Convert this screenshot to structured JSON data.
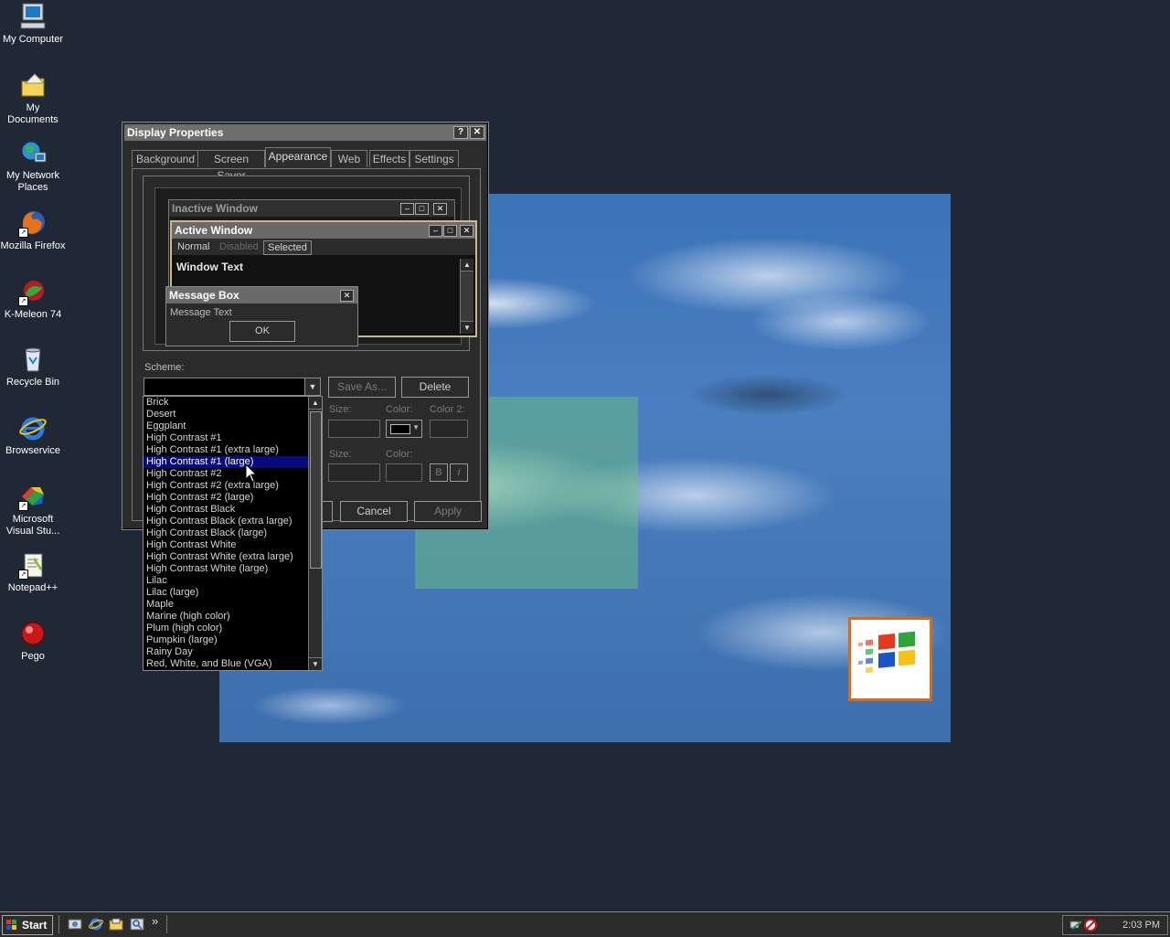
{
  "desktop": {
    "icons": [
      {
        "label": "My Computer"
      },
      {
        "label": "My Documents"
      },
      {
        "label": "My Network Places"
      },
      {
        "label": "Mozilla Firefox"
      },
      {
        "label": "K-Meleon 74"
      },
      {
        "label": "Recycle Bin"
      },
      {
        "label": "Browservice"
      },
      {
        "label": "Microsoft Visual Stu..."
      },
      {
        "label": "Notepad++"
      },
      {
        "label": "Pego"
      }
    ]
  },
  "dialog": {
    "title": "Display Properties",
    "help_glyph": "?",
    "close_glyph": "✕",
    "tabs": [
      "Background",
      "Screen Saver",
      "Appearance",
      "Web",
      "Effects",
      "Settings"
    ],
    "active_tab": "Appearance",
    "preview": {
      "inactive_title": "Inactive Window",
      "active_title": "Active Window",
      "menu_normal": "Normal",
      "menu_disabled": "Disabled",
      "menu_selected": "Selected",
      "window_text": "Window Text",
      "msgbox_title": "Message Box",
      "msgbox_text": "Message Text",
      "msgbox_ok": "OK"
    },
    "scheme_label": "Scheme:",
    "scheme_value": "",
    "save_as": "Save As...",
    "delete": "Delete",
    "size_label": "Size:",
    "color_label": "Color:",
    "color2_label": "Color 2:",
    "size2_label": "Size:",
    "color3_label": "Color:",
    "bold_label": "B",
    "italic_label": "I",
    "cancel": "Cancel",
    "apply": "Apply"
  },
  "scheme_list": {
    "items": [
      "Brick",
      "Desert",
      "Eggplant",
      "High Contrast #1",
      "High Contrast #1 (extra large)",
      "High Contrast #1 (large)",
      "High Contrast #2",
      "High Contrast #2 (extra large)",
      "High Contrast #2 (large)",
      "High Contrast Black",
      "High Contrast Black (extra large)",
      "High Contrast Black (large)",
      "High Contrast White",
      "High Contrast White (extra large)",
      "High Contrast White (large)",
      "Lilac",
      "Lilac (large)",
      "Maple",
      "Marine (high color)",
      "Plum (high color)",
      "Pumpkin (large)",
      "Rainy Day",
      "Red, White, and Blue (VGA)"
    ],
    "selected_index": 5
  },
  "taskbar": {
    "start_label": "Start",
    "more_glyph": "»",
    "clock": "2:03 PM"
  },
  "colors": {
    "desktop_bg": "#1f2834",
    "dialog_bg": "#2b2b2b",
    "selection": "#0a0a80",
    "active_border": "#c7b98a"
  }
}
